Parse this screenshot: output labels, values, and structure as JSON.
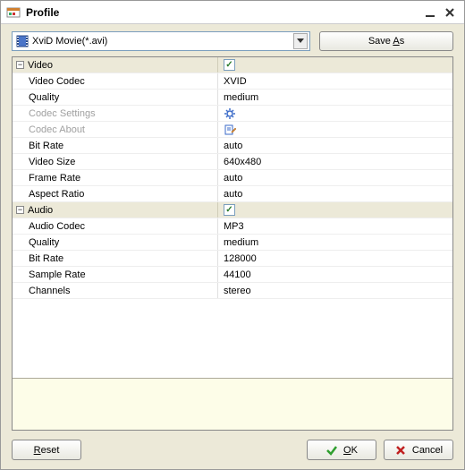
{
  "window": {
    "title": "Profile"
  },
  "toolbar": {
    "profile_selected": "XviD Movie(*.avi)",
    "save_as_label_pre": "Save ",
    "save_as_label_ul": "A",
    "save_as_label_post": "s"
  },
  "grid": {
    "groups": [
      {
        "label": "Video",
        "checked": true,
        "rows": [
          {
            "label": "Video Codec",
            "value": "XVID",
            "type": "text"
          },
          {
            "label": "Quality",
            "value": "medium",
            "type": "text"
          },
          {
            "label": "Codec Settings",
            "value": "",
            "type": "gear",
            "disabled": true
          },
          {
            "label": "Codec About",
            "value": "",
            "type": "edit",
            "disabled": true
          },
          {
            "label": "Bit Rate",
            "value": "auto",
            "type": "text"
          },
          {
            "label": "Video Size",
            "value": "640x480",
            "type": "text"
          },
          {
            "label": "Frame Rate",
            "value": "auto",
            "type": "text"
          },
          {
            "label": "Aspect Ratio",
            "value": "auto",
            "type": "text"
          }
        ]
      },
      {
        "label": "Audio",
        "checked": true,
        "rows": [
          {
            "label": "Audio Codec",
            "value": "MP3",
            "type": "text"
          },
          {
            "label": "Quality",
            "value": "medium",
            "type": "text"
          },
          {
            "label": "Bit Rate",
            "value": "128000",
            "type": "text"
          },
          {
            "label": "Sample Rate",
            "value": "44100",
            "type": "text"
          },
          {
            "label": "Channels",
            "value": "stereo",
            "type": "text"
          }
        ]
      }
    ]
  },
  "footer": {
    "reset_ul": "R",
    "reset_post": "eset",
    "ok_ul": "O",
    "ok_post": "K",
    "cancel_label": "Cancel"
  }
}
